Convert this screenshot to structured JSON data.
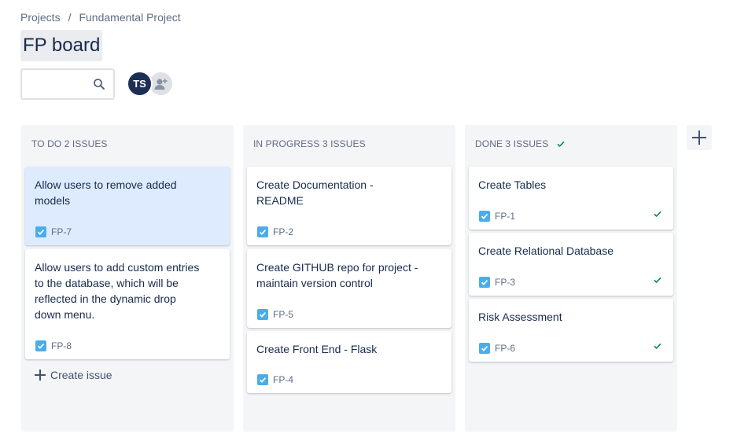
{
  "breadcrumb": {
    "projects": "Projects",
    "separator": "/",
    "project": "Fundamental Project"
  },
  "page_title": "FP board",
  "search": {
    "placeholder": ""
  },
  "avatar": {
    "initials": "TS"
  },
  "colors": {
    "avatar": "#1d2f55",
    "done_check": "#00875a",
    "story_checkbox": "#4bade8",
    "selected_card": "#deebff",
    "column_bg": "#f4f5f7"
  },
  "columns": [
    {
      "title": "TO DO 2 ISSUES",
      "cards": [
        {
          "summary": "Allow users to remove added models",
          "key": "FP-7"
        },
        {
          "summary": "Allow users to add custom entries to the database, which will be reflected in the dynamic drop down menu.",
          "key": "FP-8"
        }
      ],
      "create_label": "Create issue"
    },
    {
      "title": "IN PROGRESS 3 ISSUES",
      "cards": [
        {
          "summary": "Create Documentation - README",
          "key": "FP-2"
        },
        {
          "summary": "Create GITHUB repo for project - maintain version control",
          "key": "FP-5"
        },
        {
          "summary": "Create Front End - Flask",
          "key": "FP-4"
        }
      ]
    },
    {
      "title": "DONE 3 ISSUES",
      "cards": [
        {
          "summary": "Create Tables",
          "key": "FP-1"
        },
        {
          "summary": "Create Relational Database",
          "key": "FP-3"
        },
        {
          "summary": "Risk Assessment",
          "key": "FP-6"
        }
      ]
    }
  ]
}
